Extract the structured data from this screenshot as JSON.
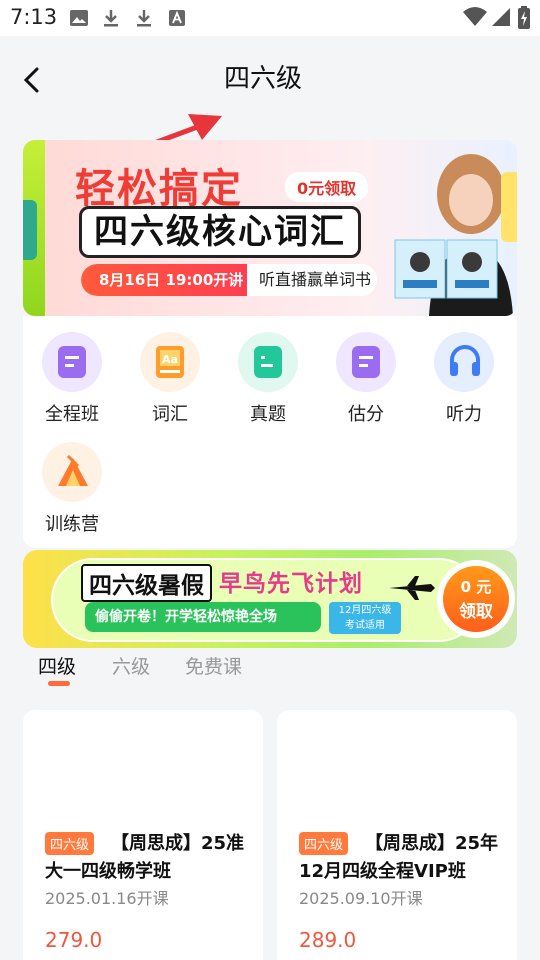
{
  "status_bar": {
    "time": "7:13",
    "left_icons": [
      "image-icon",
      "download-icon",
      "download-icon",
      "font-icon"
    ],
    "right_icons": [
      "wifi-icon",
      "signal-icon",
      "battery-icon"
    ]
  },
  "header": {
    "title": "四六级"
  },
  "banner_top": {
    "title": "轻松搞定",
    "tag": "0元领取",
    "subtitle": "四六级核心词汇",
    "date": "8月16日 19:00开讲",
    "pill_text": "听直播赢单词书"
  },
  "categories": [
    {
      "label": "全程班",
      "icon": "course-icon",
      "color": "#9b6cf0",
      "bg": "#efe6ff"
    },
    {
      "label": "词汇",
      "icon": "vocabulary-icon",
      "color": "#ff9c2b",
      "bg": "#fff1e3"
    },
    {
      "label": "真题",
      "icon": "exam-icon",
      "color": "#22c79a",
      "bg": "#e1f8f1"
    },
    {
      "label": "估分",
      "icon": "score-icon",
      "color": "#9b6cf0",
      "bg": "#efe6ff"
    },
    {
      "label": "听力",
      "icon": "headphones-icon",
      "color": "#3d7cf5",
      "bg": "#e5eeff"
    },
    {
      "label": "训练营",
      "icon": "camp-icon",
      "color": "#ff7a2b",
      "bg": "#fff1e3"
    }
  ],
  "banner_mid": {
    "title_a": "四六级暑假",
    "title_b": "早鸟先飞计划",
    "sub": "偷偷开卷！开学轻松惊艳全场",
    "small_a": "12月四六级",
    "small_b": "考试适用",
    "cta_a": "0 元",
    "cta_b": "领取"
  },
  "tabs": [
    {
      "label": "四级",
      "active": true
    },
    {
      "label": "六级",
      "active": false
    },
    {
      "label": "免费课",
      "active": false
    }
  ],
  "courses": [
    {
      "badge": "四六级",
      "title": "【周思成】25准大一四级畅学班",
      "date": "2025.01.16开课",
      "price": "279.0"
    },
    {
      "badge": "四六级",
      "title": "【周思成】25年12月四级全程VIP班",
      "date": "2025.09.10开课",
      "price": "289.0"
    }
  ]
}
